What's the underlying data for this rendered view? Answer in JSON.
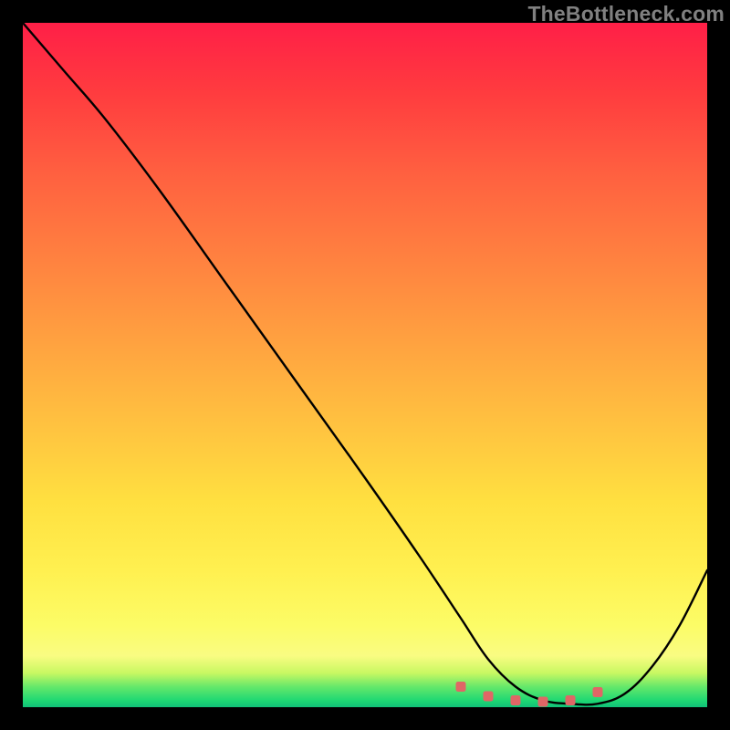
{
  "watermark": "TheBottleneck.com",
  "chart_data": {
    "type": "line",
    "title": "",
    "xlabel": "",
    "ylabel": "",
    "xlim": [
      0,
      100
    ],
    "ylim": [
      0,
      100
    ],
    "series": [
      {
        "name": "curve",
        "x": [
          0,
          6,
          12,
          20,
          30,
          40,
          50,
          58,
          64,
          68,
          72,
          76,
          80,
          84,
          88,
          92,
          96,
          100
        ],
        "y": [
          100,
          93,
          86,
          75.5,
          61.5,
          47.5,
          33.5,
          22,
          13,
          7,
          3,
          1,
          0.5,
          0.5,
          2,
          6,
          12,
          20
        ]
      },
      {
        "name": "flat-markers",
        "x": [
          64,
          68,
          72,
          76,
          80,
          84
        ],
        "y": [
          3.0,
          1.6,
          1.0,
          0.8,
          1.0,
          2.2
        ]
      }
    ],
    "colors": {
      "curve_stroke": "#000000",
      "marker_fill": "#e06666",
      "gradient_top": "#ff1f47",
      "gradient_bottom": "#10c078"
    }
  }
}
